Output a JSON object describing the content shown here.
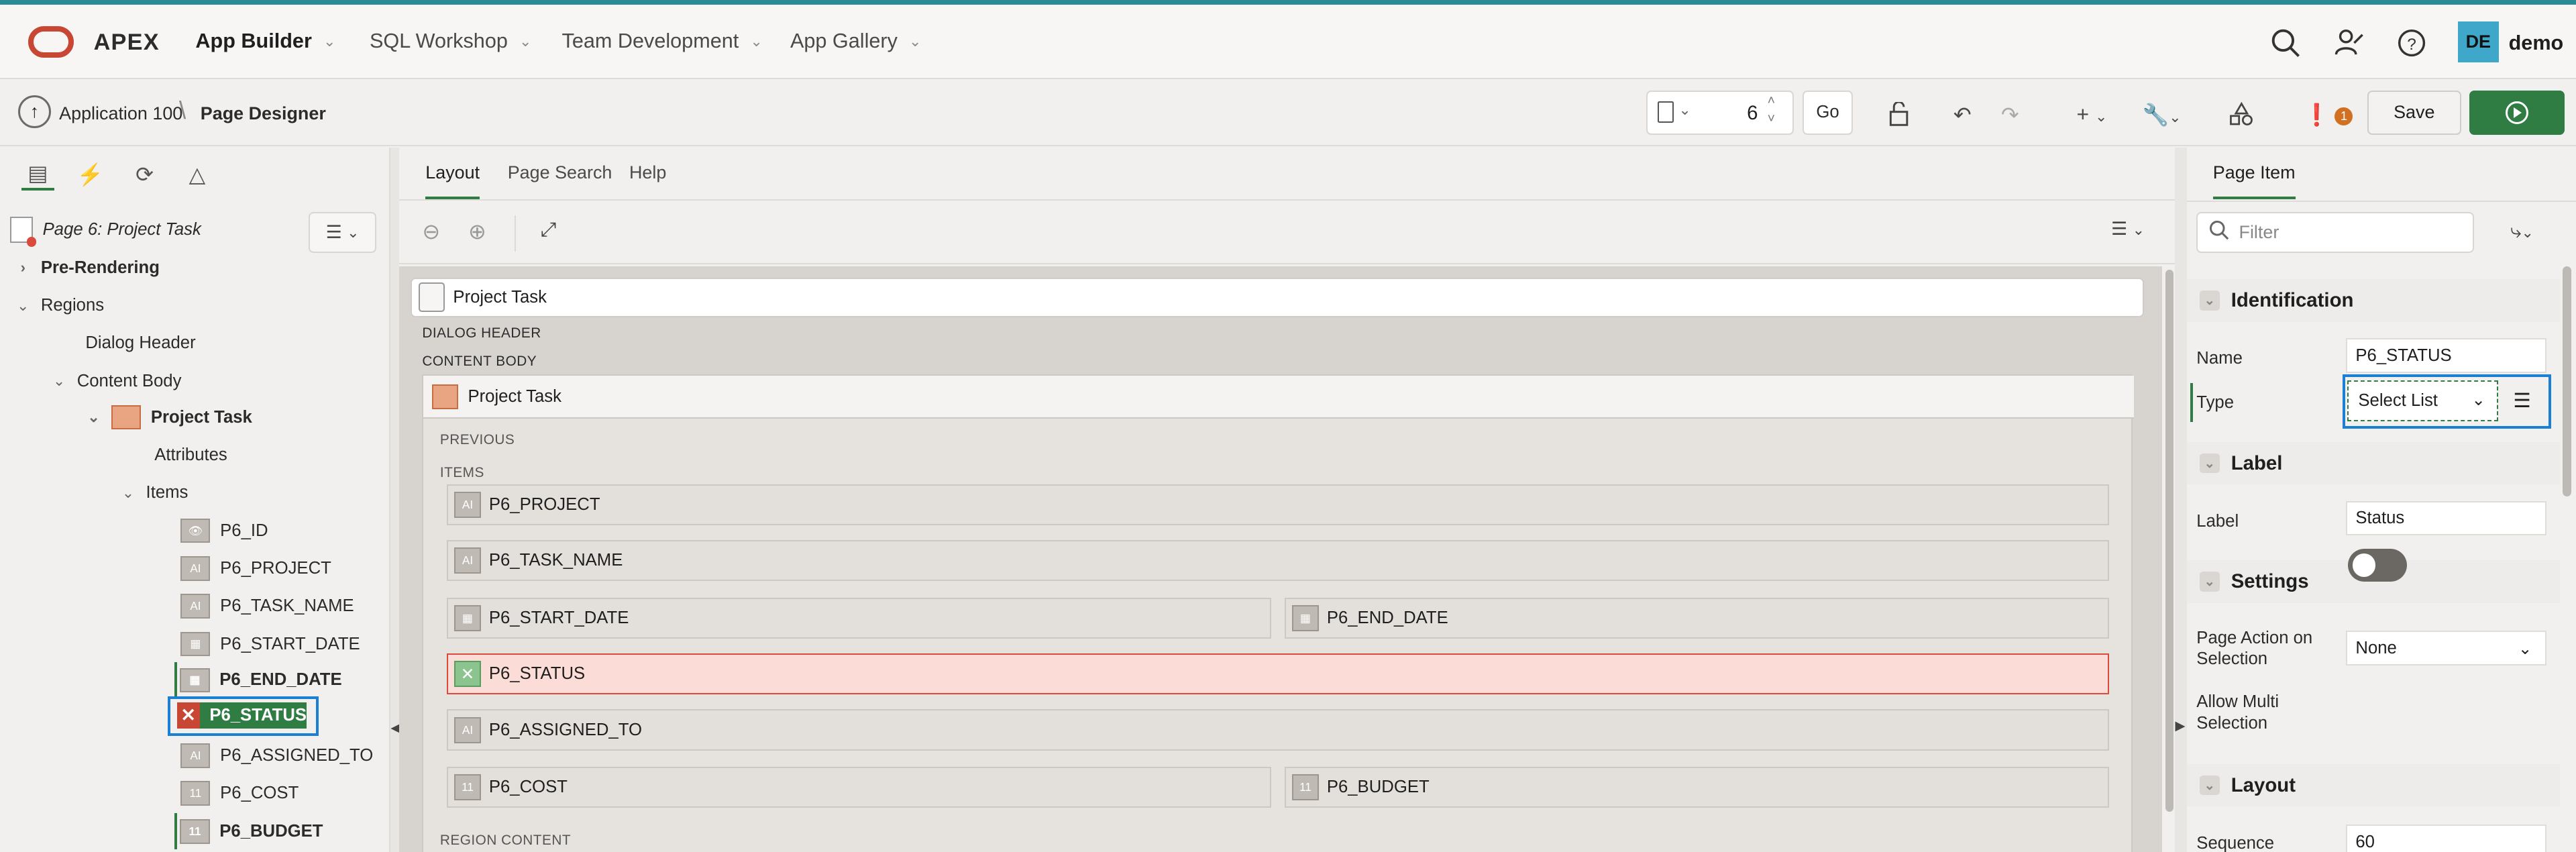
{
  "header": {
    "brand": "APEX",
    "nav": [
      {
        "label": "App Builder",
        "active": true
      },
      {
        "label": "SQL Workshop",
        "active": false
      },
      {
        "label": "Team Development",
        "active": false
      },
      {
        "label": "App Gallery",
        "active": false
      }
    ],
    "user_initials": "DE",
    "user_name": "demo",
    "icons": [
      "search-icon",
      "admin-icon",
      "help-icon"
    ],
    "avatar_color": "#3fa7c9"
  },
  "toolbar": {
    "breadcrumb_app": "Application 100",
    "breadcrumb_page": "Page Designer",
    "page_number": "6",
    "go_label": "Go",
    "issues_count": "1",
    "save_label": "Save",
    "run_color": "#2f7d42"
  },
  "left": {
    "page_title": "Page 6: Project Task",
    "tree": [
      {
        "label": "Pre-Rendering",
        "bold": true
      },
      {
        "label": "Regions"
      },
      {
        "label": "Dialog Header"
      },
      {
        "label": "Content Body"
      },
      {
        "label": "Project Task",
        "bold": true
      },
      {
        "label": "Attributes"
      },
      {
        "label": "Items"
      },
      {
        "label": "P6_ID"
      },
      {
        "label": "P6_PROJECT"
      },
      {
        "label": "P6_TASK_NAME"
      },
      {
        "label": "P6_START_DATE"
      },
      {
        "label": "P6_END_DATE",
        "bold": true
      },
      {
        "label": "P6_STATUS",
        "selected": true
      },
      {
        "label": "P6_ASSIGNED_TO"
      },
      {
        "label": "P6_COST"
      },
      {
        "label": "P6_BUDGET",
        "bold": true
      }
    ]
  },
  "center": {
    "tabs": [
      "Layout",
      "Page Search",
      "Help"
    ],
    "page_bar": "Project Task",
    "dialog_header": "DIALOG HEADER",
    "content_body": "CONTENT BODY",
    "region_title": "Project Task",
    "previous": "PREVIOUS",
    "items_label": "ITEMS",
    "region_content": "REGION CONTENT",
    "fields": {
      "project": "P6_PROJECT",
      "task_name": "P6_TASK_NAME",
      "start_date": "P6_START_DATE",
      "end_date": "P6_END_DATE",
      "status": "P6_STATUS",
      "assigned_to": "P6_ASSIGNED_TO",
      "cost": "P6_COST",
      "budget": "P6_BUDGET"
    },
    "error_color": "#fbdcd7"
  },
  "right": {
    "tab": "Page Item",
    "filter_placeholder": "Filter",
    "identification": "Identification",
    "name_label": "Name",
    "name_value": "P6_STATUS",
    "type_label": "Type",
    "type_value": "Select List",
    "label_section": "Label",
    "label_label": "Label",
    "label_value": "Status",
    "settings": "Settings",
    "page_action_label": "Page Action on Selection",
    "page_action_value": "None",
    "allow_multi_label": "Allow Multi Selection",
    "allow_multi_on": false,
    "layout": "Layout",
    "sequence_label": "Sequence",
    "sequence_value": "60"
  }
}
